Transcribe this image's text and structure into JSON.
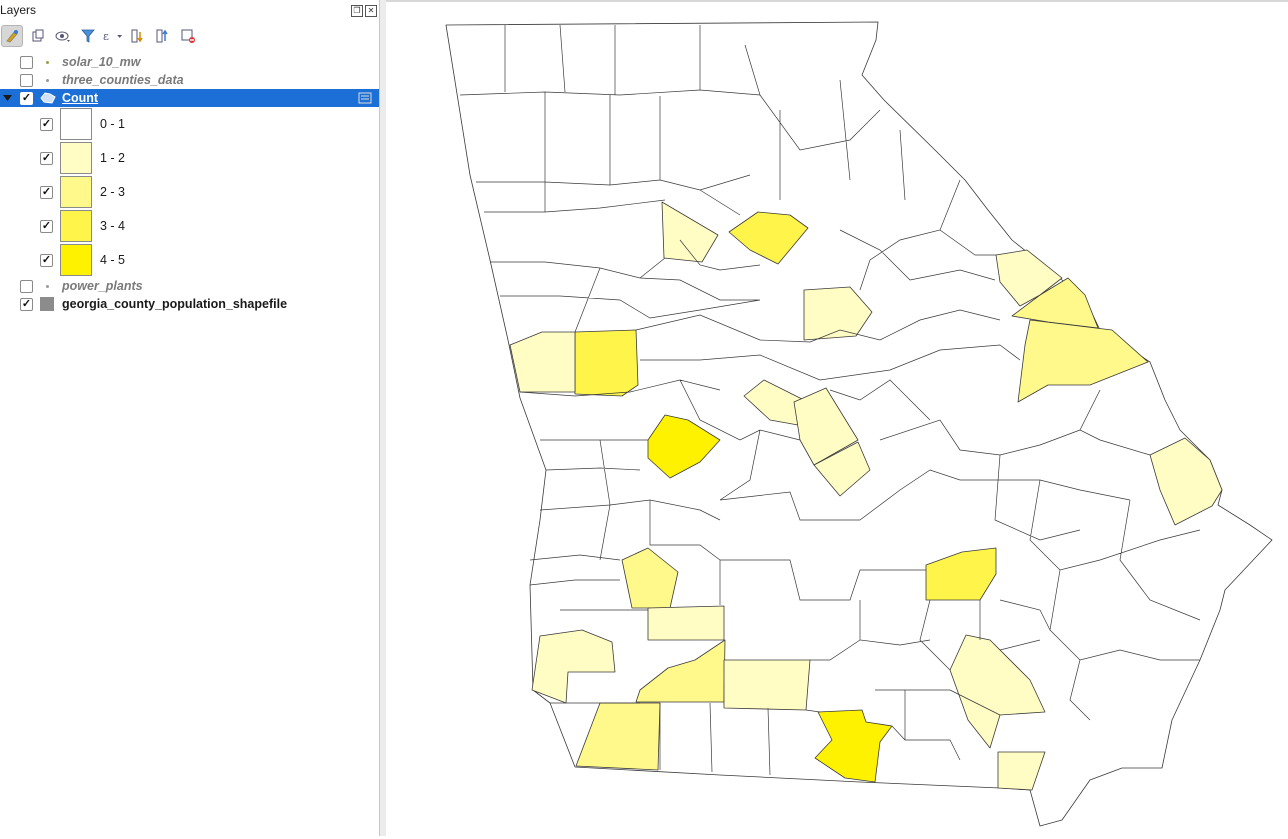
{
  "panel": {
    "title": "Layers"
  },
  "toolbar": {
    "icons": [
      "open-layer-styling-icon",
      "add-group-icon",
      "manage-map-themes-icon",
      "filter-legend-icon",
      "filter-by-expression-icon",
      "expand-all-icon",
      "collapse-all-icon",
      "remove-layer-icon"
    ]
  },
  "layers": {
    "solar": {
      "name": "solar_10_mw",
      "checked": false
    },
    "three": {
      "name": "three_counties_data",
      "checked": false
    },
    "count": {
      "name": "Count",
      "checked": true,
      "expanded": true
    },
    "power": {
      "name": "power_plants",
      "checked": false
    },
    "georgia": {
      "name": "georgia_county_population_shapefile",
      "checked": true
    }
  },
  "legend": [
    {
      "label": "0 - 1",
      "color": "#ffffff"
    },
    {
      "label": "1 - 2",
      "color": "#fffcc4"
    },
    {
      "label": "2 - 3",
      "color": "#fff88a"
    },
    {
      "label": "3 - 4",
      "color": "#fff54a"
    },
    {
      "label": "4 - 5",
      "color": "#fff200"
    }
  ],
  "check_mark": "✓"
}
